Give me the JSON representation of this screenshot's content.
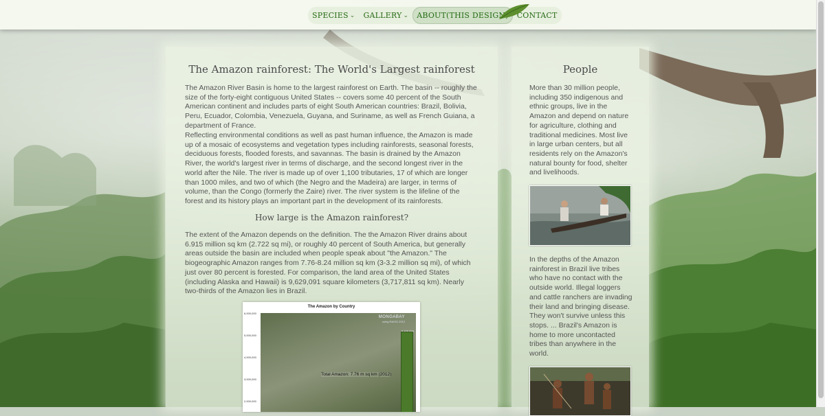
{
  "nav": {
    "items": [
      {
        "label": "SPECIES",
        "has_dropdown": true
      },
      {
        "label": "GALLERY",
        "has_dropdown": true
      },
      {
        "label": "ABOUT(THIS DESIGN)",
        "has_dropdown": false,
        "active": true
      },
      {
        "label": "CONTACT",
        "has_dropdown": false
      }
    ],
    "caret_icon": "chevron-down-icon",
    "accent_color": "#256b14"
  },
  "main": {
    "title": "The Amazon rainforest: The World's Largest rainforest",
    "paragraph_1": "The Amazon River Basin is home to the largest rainforest on Earth. The basin -- roughly the size of the forty-eight contiguous United States -- covers some 40 percent of the South American continent and includes parts of eight South American countries: Brazil, Bolivia, Peru, Ecuador, Colombia, Venezuela, Guyana, and Suriname, as well as French Guiana, a department of France.",
    "paragraph_2": "Reflecting environmental conditions as well as past human influence, the Amazon is made up of a mosaic of ecosystems and vegetation types including rainforests, seasonal forests, deciduous forests, flooded forests, and savannas. The basin is drained by the Amazon River, the world's largest river in terms of discharge, and the second longest river in the world after the Nile. The river is made up of over 1,100 tributaries, 17 of which are longer than 1000 miles, and two of which (the Negro and the Madeira) are larger, in terms of volume, than the Congo (formerly the Zaire) river. The river system is the lifeline of the forest and its history plays an important part in the development of its rainforests.",
    "subtitle": "How large is the Amazon rainforest?",
    "paragraph_3": "The extent of the Amazon depends on the definition. The the Amazon River drains about 6.915 million sq km (2.722 sq mi), or roughly 40 percent of South America, but generally areas outside the basin are included when people speak about \"the Amazon.\" The biogeographic Amazon ranges from 7.76-8.24 million sq km (3-3.2 million sq mi), of which just over 80 percent is forested. For comparison, the land area of the United States (including Alaska and Hawaii) is 9,629,091 square kilometers (3,717,811 sq km). Nearly two-thirds of the Amazon lies in Brazil."
  },
  "figure": {
    "title": "The Amazon by Country",
    "watermark": "MONGABAY",
    "watermark_sub": "using RAISG 2012",
    "annotation": "Total Amazon: 7.76 m sq km (2012)",
    "y_ticks": [
      "6,000,000",
      "5,000,000",
      "4,000,000",
      "3,000,000",
      "2,000,000"
    ],
    "bar_label": "5,406,698",
    "bar_value": 5406698
  },
  "side": {
    "title": "People",
    "paragraph_1": "More than 30 million people, including 350 indigenous and ethnic groups, live in the Amazon and depend on nature for agriculture, clothing and traditional medicines. Most live in large urban centers, but all residents rely on the Amazon's natural bounty for food, shelter and livelihoods.",
    "paragraph_2": "In the depths of the Amazon rainforest in Brazil live tribes who have no contact with the outside world. Illegal loggers and cattle ranchers are invading their land and bringing disease. They won't survive unless this stops. ... Brazil's Amazon is home to more uncontacted tribes than anywhere in the world."
  }
}
